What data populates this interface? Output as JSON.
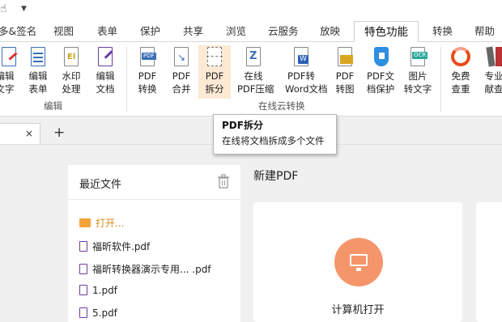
{
  "tabs": [
    "多&签名",
    "视图",
    "表单",
    "保护",
    "共享",
    "浏览",
    "云服务",
    "放映",
    "特色功能",
    "转换",
    "帮助"
  ],
  "active_tab": "特色功能",
  "ribbon": {
    "buttons": [
      {
        "l1": "编辑",
        "l2": "文字"
      },
      {
        "l1": "编辑",
        "l2": "表单"
      },
      {
        "l1": "水印",
        "l2": "处理"
      },
      {
        "l1": "编辑",
        "l2": "文档"
      },
      {
        "l1": "PDF",
        "l2": "转换"
      },
      {
        "l1": "PDF",
        "l2": "合并"
      },
      {
        "l1": "PDF",
        "l2": "拆分"
      },
      {
        "l1": "在线",
        "l2": "PDF压缩"
      },
      {
        "l1": "PDF转",
        "l2": "Word文档"
      },
      {
        "l1": "PDF",
        "l2": "转图"
      },
      {
        "l1": "PDF文",
        "l2": "档保护"
      },
      {
        "l1": "图片",
        "l2": "转文字"
      },
      {
        "l1": "免费",
        "l2": "查重"
      },
      {
        "l1": "专业",
        "l2": "献查"
      }
    ],
    "groups": {
      "edit": "编辑",
      "online": "在线云转换"
    }
  },
  "tooltip": {
    "title": "PDF拆分",
    "desc": "在线将文档拆成多个文件"
  },
  "doc_tab": {
    "close": "×",
    "add": "+"
  },
  "recent": {
    "title": "最近文件",
    "open_label": "打开...",
    "files": [
      "福昕软件.pdf",
      "福昕转换器演示专用...  .pdf",
      "1.pdf",
      "5.pdf"
    ]
  },
  "new_pdf": {
    "title": "新建PDF",
    "card_label": "计算机打开"
  },
  "colors": {
    "accent": "#f5956a",
    "folder": "#f2a33a",
    "highlight": "#fde9d4"
  }
}
